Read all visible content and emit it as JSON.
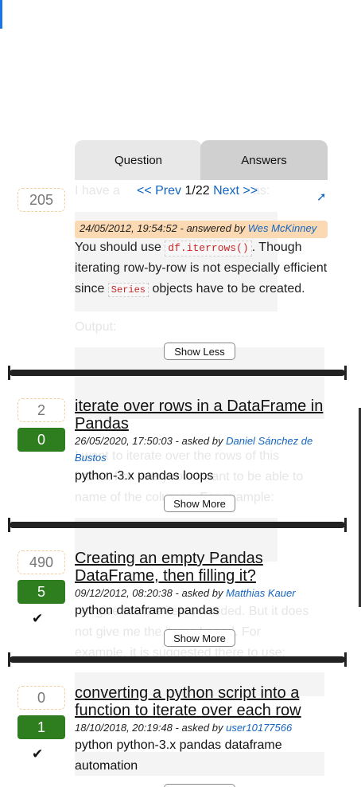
{
  "tabs": {
    "question": "Question",
    "answers": "Answers"
  },
  "pager": {
    "prev": "<< Prev",
    "position": "1/22",
    "next": "Next >>"
  },
  "top_item": {
    "score": "205",
    "meta_date": "24/05/2012, 19:54:52",
    "meta_action": " - answered by ",
    "user": "Wes McKinney",
    "body_1": "You should use ",
    "code_1": "df.iterrows()",
    "body_2": ". Though iterating row-by-row is not especially efficient since ",
    "code_2": "Series",
    "body_3": " objects have to be created.",
    "toggle_label": "Show Less"
  },
  "questions": [
    {
      "score": "2",
      "answers": "0",
      "accepted": false,
      "title": "iterate over rows in a DataFrame in Pandas",
      "date": "26/05/2020, 17:50:03",
      "action": " - asked by ",
      "user": "Daniel Sánchez de Bustos",
      "tags": "python-3.x pandas loops",
      "toggle_label": "Show More"
    },
    {
      "score": "490",
      "answers": "5",
      "accepted": true,
      "title": "Creating an empty Pandas DataFrame, then filling it?",
      "date": "09/12/2012, 08:20:38",
      "action": " - asked by ",
      "user": "Matthias Kauer",
      "tags": "python dataframe pandas",
      "toggle_label": "Show More"
    },
    {
      "score": "0",
      "answers": "1",
      "accepted": true,
      "title": "converting a python script into a function to iterate over each row",
      "date": "18/10/2018, 20:19:48",
      "action": " - asked by ",
      "user": "user10177566",
      "tags": "python python-3.x pandas dataframe automation"
    }
  ],
  "icons": {
    "expand": "expand-icon",
    "accepted": "checkmark-icon"
  },
  "colors": {
    "link": "#1565c0",
    "accepted_bg": "#2e7d1e",
    "answered_meta_bg": "#fbd9b3"
  }
}
